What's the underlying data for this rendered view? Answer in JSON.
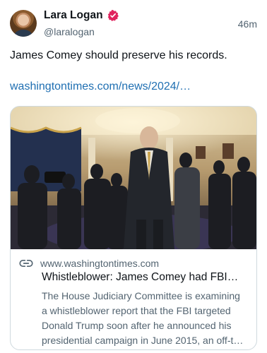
{
  "author": {
    "name": "Lara Logan",
    "handle": "@laralogan",
    "time": "46m",
    "verified_icon": "verified-badge-icon",
    "verified_color": "#e0245e"
  },
  "tweet": {
    "text": "James Comey should preserve his records.",
    "link": "washingtontimes.com/news/2024/…"
  },
  "card": {
    "image_icon": "news-photo",
    "link_icon": "link-icon",
    "domain": "www.washingtontimes.com",
    "title": "Whistleblower: James Comey had FBI…",
    "description_lines": [
      "The House Judiciary Committee is examining",
      "a whistleblower report that the FBI targeted",
      "Donald Trump soon after he announced his",
      "presidential campaign in June 2015, an off-t…"
    ]
  },
  "colors": {
    "link": "#1f6fb2",
    "secondary_text": "#536471",
    "border": "#cfd9de"
  }
}
